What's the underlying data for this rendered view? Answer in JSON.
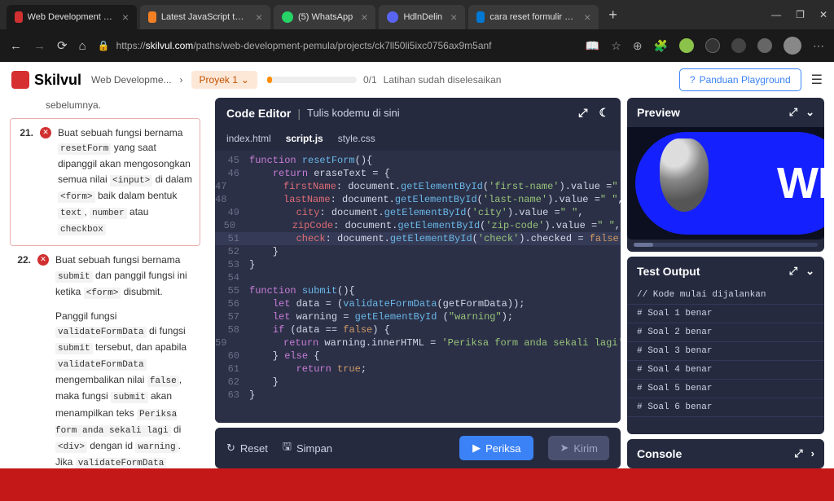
{
  "browser": {
    "tabs": [
      {
        "title": "Web Development Pemula - [...]"
      },
      {
        "title": "Latest JavaScript topics - For..."
      },
      {
        "title": "(5) WhatsApp"
      },
      {
        "title": "HdlnDelin"
      },
      {
        "title": "cara reset formulir di javascr..."
      }
    ],
    "url_prefix": "https://",
    "url_domain": "skilvul.com",
    "url_path": "/paths/web-development-pemula/projects/ck7ll50li5ixc0756ax9m5anf"
  },
  "header": {
    "logo": "Skilvul",
    "breadcrumb_path": "Web Developme...",
    "breadcrumb_proj": "Proyek 1",
    "progress_count": "0/1",
    "progress_label": "Latihan sudah diselesaikan",
    "panduan": "Panduan Playground"
  },
  "instructions": {
    "prev": "sebelumnya.",
    "n21": "21.",
    "t21_a": "Buat sebuah fungsi bernama ",
    "t21_code1": "resetForm",
    "t21_b": " yang saat dipanggil akan mengosongkan semua nilai ",
    "t21_code2": "<input>",
    "t21_c": " di dalam ",
    "t21_code3": "<form>",
    "t21_d": " baik dalam bentuk ",
    "t21_code4": "text",
    "t21_e": ", ",
    "t21_code5": "number",
    "t21_f": " atau ",
    "t21_code6": "checkbox",
    "n22": "22.",
    "t22_a": "Buat sebuah fungsi bernama ",
    "t22_code1": "submit",
    "t22_b": " dan panggil fungsi ini ketika ",
    "t22_code2": "<form>",
    "t22_c": " disubmit.",
    "t22_p2a": "Panggil fungsi ",
    "t22_p2code1": "validateFormData",
    "t22_p2b": " di fungsi ",
    "t22_p2code2": "submit",
    "t22_p2c": " tersebut, dan apabila ",
    "t22_p2code3": "validateFormData",
    "t22_p2d": " mengembalikan nilai ",
    "t22_p2code4": "false",
    "t22_p2e": ", maka fungsi ",
    "t22_p2code5": "submit",
    "t22_p2f": " akan menampilkan teks ",
    "t22_p2code6": "Periksa form anda sekali lagi",
    "t22_p2g": " di ",
    "t22_p2code7": "<div>",
    "t22_p2h": " dengan id ",
    "t22_p2code8": "warning",
    "t22_p2i": ". Jika ",
    "t22_p2code9": "validateFormData"
  },
  "editor": {
    "title": "Code Editor",
    "subtitle": "Tulis kodemu di sini",
    "tabs": [
      "index.html",
      "script.js",
      "style.css"
    ],
    "lines": [
      {
        "n": 45,
        "html": "<span class='kw'>function</span> <span class='fn'>resetForm</span>(){"
      },
      {
        "n": 46,
        "html": "    <span class='kw'>return</span> eraseText <span class='op'>=</span> {"
      },
      {
        "n": 47,
        "html": "        <span class='prop'>firstName</span>: document.<span class='fn'>getElementById</span>(<span class='str'>'first-name'</span>).value <span class='op'>=</span><span class='str'>\" \"</span>,"
      },
      {
        "n": 48,
        "html": "        <span class='prop'>lastName</span>: document.<span class='fn'>getElementById</span>(<span class='str'>'last-name'</span>).value <span class='op'>=</span><span class='str'>\" \"</span>,"
      },
      {
        "n": 49,
        "html": "        <span class='prop'>city</span>: document.<span class='fn'>getElementById</span>(<span class='str'>'city'</span>).value <span class='op'>=</span><span class='str'>\" \"</span>,"
      },
      {
        "n": 50,
        "html": "        <span class='prop'>zipCode</span>: document.<span class='fn'>getElementById</span>(<span class='str'>'zip-code'</span>).value <span class='op'>=</span><span class='str'>\" \"</span>,"
      },
      {
        "n": 51,
        "html": "        <span class='prop'>check</span>: document.<span class='fn'>getElementById</span>(<span class='str'>'check'</span>).checked <span class='op'>=</span> <span class='bool'>false</span>",
        "hl": true
      },
      {
        "n": 52,
        "html": "    }"
      },
      {
        "n": 53,
        "html": "}"
      },
      {
        "n": 54,
        "html": ""
      },
      {
        "n": 55,
        "html": "<span class='kw'>function</span> <span class='fn'>submit</span>(){"
      },
      {
        "n": 56,
        "html": "    <span class='kw'>let</span> data <span class='op'>=</span> (<span class='fn'>validateFormData</span>(getFormData));"
      },
      {
        "n": 57,
        "html": "    <span class='kw'>let</span> warning <span class='op'>=</span> <span class='fn'>getElementById</span> (<span class='str'>\"warning\"</span>);"
      },
      {
        "n": 58,
        "html": "    <span class='kw'>if</span> (data <span class='op'>==</span> <span class='bool'>false</span>) {"
      },
      {
        "n": 59,
        "html": "        <span class='kw'>return</span> warning.innerHTML <span class='op'>=</span> <span class='str'>'Periksa form anda sekali lagi'</span>"
      },
      {
        "n": 60,
        "html": "    } <span class='kw'>else</span> {"
      },
      {
        "n": 61,
        "html": "        <span class='kw'>return</span> <span class='bool'>true</span>;"
      },
      {
        "n": 62,
        "html": "    }"
      },
      {
        "n": 63,
        "html": "}"
      }
    ]
  },
  "actions": {
    "reset": "Reset",
    "simpan": "Simpan",
    "periksa": "Periksa",
    "kirim": "Kirim"
  },
  "preview": {
    "title": "Preview",
    "big_text": "WR"
  },
  "test": {
    "title": "Test Output",
    "lines": [
      "// Kode mulai dijalankan",
      "# Soal 1 benar",
      "# Soal 2 benar",
      "# Soal 3 benar",
      "# Soal 4 benar",
      "# Soal 5 benar",
      "# Soal 6 benar"
    ]
  },
  "console": {
    "title": "Console"
  }
}
